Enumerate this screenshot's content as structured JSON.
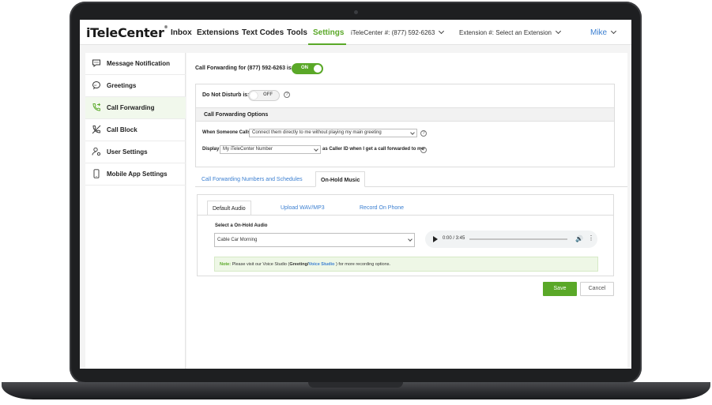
{
  "app": {
    "logo_text": "iTeleCenter",
    "logo_mark": "®"
  },
  "nav": {
    "items": [
      {
        "label": "Inbox"
      },
      {
        "label": "Extensions"
      },
      {
        "label": "Text Codes"
      },
      {
        "label": "Tools"
      },
      {
        "label": "Settings",
        "active": true
      }
    ],
    "number_select": "iTeleCenter #: (877) 592-6263",
    "extension_select": "Extension #: Select an Extension",
    "user": "Mike"
  },
  "sidebar": {
    "items": [
      {
        "label": "Message Notification",
        "icon": "chat-bubble-icon"
      },
      {
        "label": "Greetings",
        "icon": "greeting-bubble-icon"
      },
      {
        "label": "Call Forwarding",
        "icon": "phone-forward-icon",
        "active": true
      },
      {
        "label": "Call Block",
        "icon": "phone-block-icon"
      },
      {
        "label": "User Settings",
        "icon": "user-gear-icon"
      },
      {
        "label": "Mobile App Settings",
        "icon": "mobile-phone-icon"
      }
    ]
  },
  "call_forwarding": {
    "label": "Call Forwarding for (877) 592-6263 is:",
    "toggle": "ON"
  },
  "dnd": {
    "label": "Do Not Disturb is:",
    "toggle": "OFF",
    "help": "?"
  },
  "options": {
    "header": "Call Forwarding Options",
    "when_label": "When Someone Calls",
    "when_value": "Connect them directly to me without playing my main greeting",
    "display_label": "Display",
    "display_value": "My iTeleCenter Number",
    "display_suffix": "as Caller ID when I get a call forwarded to me"
  },
  "tabs": {
    "primary": [
      "Call Forwarding Numbers and Schedules",
      "On-Hold Music"
    ],
    "primary_selected": 1,
    "secondary": [
      "Default Audio",
      "Upload WAV/MP3",
      "Record On Phone"
    ],
    "secondary_selected": 0
  },
  "on_hold": {
    "label": "Select a On-Hold Audio",
    "selected": "Cable Car Morning",
    "audio_time": "0:00 / 3:45",
    "audio_progress": 0.0,
    "note_prefix": "Note:",
    "note_text_1": "Please visit our Voice Studio (",
    "note_greeting": "Greeting",
    "note_slash": "/",
    "note_voice_studio": "Voice Studio",
    "note_text_2": ") for more recording options."
  },
  "buttons": {
    "save": "Save",
    "cancel": "Cancel"
  },
  "colors": {
    "accent": "#5aa828",
    "link": "#3b7fd1"
  }
}
